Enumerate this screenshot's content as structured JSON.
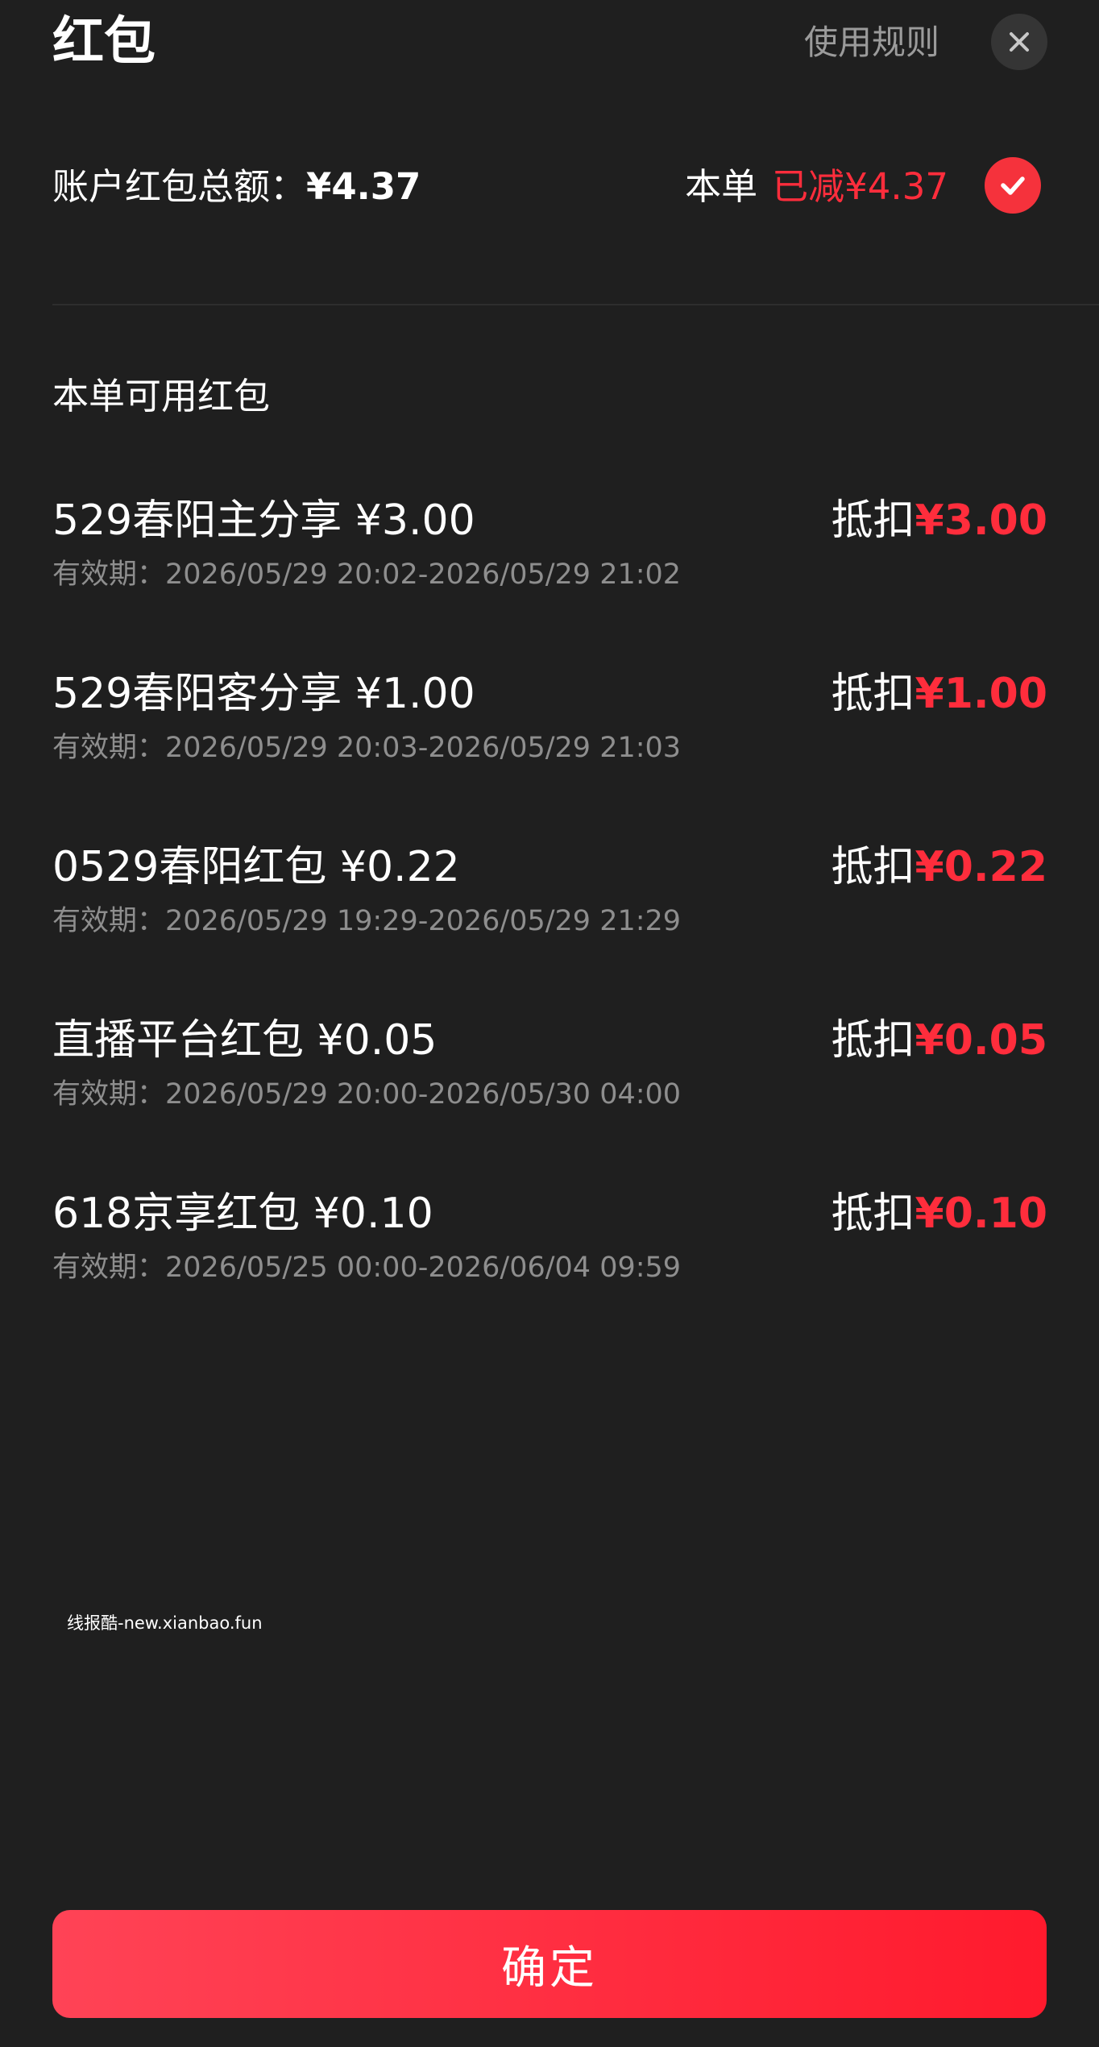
{
  "header": {
    "title": "红包",
    "rules_label": "使用规则"
  },
  "summary": {
    "total_label": "账户红包总额：",
    "total_amount": "¥4.37",
    "deducted_prefix": "本单",
    "deducted_value": "已减¥4.37"
  },
  "section": {
    "title": "本单可用红包"
  },
  "coupons": [
    {
      "name": "529春阳主分享 ¥3.00",
      "validity": "有效期：2026/05/29 20:02-2026/05/29 21:02",
      "deduct_label": "抵扣",
      "deduct_amount": "¥3.00"
    },
    {
      "name": "529春阳客分享 ¥1.00",
      "validity": "有效期：2026/05/29 20:03-2026/05/29 21:03",
      "deduct_label": "抵扣",
      "deduct_amount": "¥1.00"
    },
    {
      "name": "0529春阳红包 ¥0.22",
      "validity": "有效期：2026/05/29 19:29-2026/05/29 21:29",
      "deduct_label": "抵扣",
      "deduct_amount": "¥0.22"
    },
    {
      "name": "直播平台红包 ¥0.05",
      "validity": "有效期：2026/05/29 20:00-2026/05/30 04:00",
      "deduct_label": "抵扣",
      "deduct_amount": "¥0.05"
    },
    {
      "name": "618京享红包 ¥0.10",
      "validity": "有效期：2026/05/25 00:00-2026/06/04 09:59",
      "deduct_label": "抵扣",
      "deduct_amount": "¥0.10"
    }
  ],
  "watermark": "线报酷-new.xianbao.fun",
  "confirm_label": "确定",
  "colors": {
    "background": "#1f1f1f",
    "accent_red": "#ff2d3c",
    "muted_text": "#8e8e8e"
  },
  "icons": {
    "close": "close-icon",
    "check": "check-icon"
  }
}
